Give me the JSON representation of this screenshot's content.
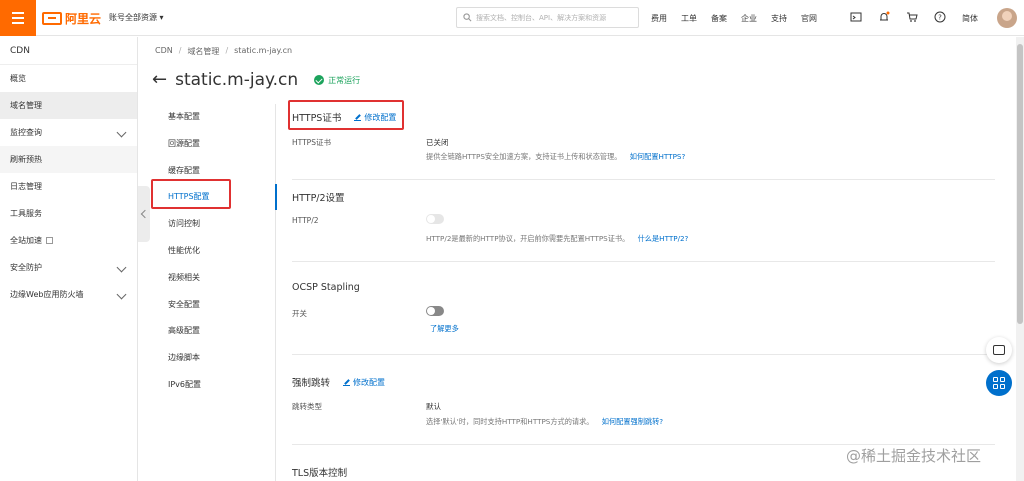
{
  "topbar": {
    "logo_text": "阿里云",
    "account_switch": "账号全部资源 ▾",
    "search_placeholder": "搜索文档、控制台、API、解决方案和资源",
    "nav": [
      "费用",
      "工单",
      "备案",
      "企业",
      "支持",
      "官网"
    ],
    "language": "简体",
    "brand_color": "#ff6a00"
  },
  "sidebar": {
    "title": "CDN",
    "items": [
      {
        "label": "概览"
      },
      {
        "label": "域名管理"
      },
      {
        "label": "监控查询"
      },
      {
        "label": "刷新预热"
      },
      {
        "label": "日志管理"
      },
      {
        "label": "工具服务"
      },
      {
        "label": "全站加速"
      },
      {
        "label": "安全防护"
      },
      {
        "label": "边缘Web应用防火墙"
      }
    ]
  },
  "breadcrumb": [
    "CDN",
    "域名管理",
    "static.m-jay.cn"
  ],
  "page": {
    "title": "static.m-jay.cn",
    "status": "正常运行",
    "status_color": "#1ca35c"
  },
  "inner_nav": [
    "基本配置",
    "回源配置",
    "缓存配置",
    "HTTPS配置",
    "访问控制",
    "性能优化",
    "视频相关",
    "安全配置",
    "高级配置",
    "边缘脚本",
    "IPv6配置"
  ],
  "sections": {
    "https": {
      "title": "HTTPS证书",
      "edit": "修改配置",
      "label": "HTTPS证书",
      "value": "已关闭",
      "desc": "提供全链路HTTPS安全加速方案，支持证书上传和状态管理。",
      "link": "如何配置HTTPS?"
    },
    "http2": {
      "title": "HTTP/2设置",
      "label": "HTTP/2",
      "desc": "HTTP/2是最新的HTTP协议，开启前你需要先配置HTTPS证书。",
      "link": "什么是HTTP/2?"
    },
    "ocsp": {
      "title": "OCSP Stapling",
      "label": "开关",
      "link": "了解更多"
    },
    "redirect": {
      "title": "强制跳转",
      "edit": "修改配置",
      "label": "跳转类型",
      "value": "默认",
      "desc": "选择'默认'时，同时支持HTTP和HTTPS方式的请求。",
      "link": "如何配置强制跳转?"
    },
    "tls": {
      "title": "TLS版本控制"
    }
  },
  "watermark": "@稀土掘金技术社区",
  "accent_color": "#0070cc"
}
